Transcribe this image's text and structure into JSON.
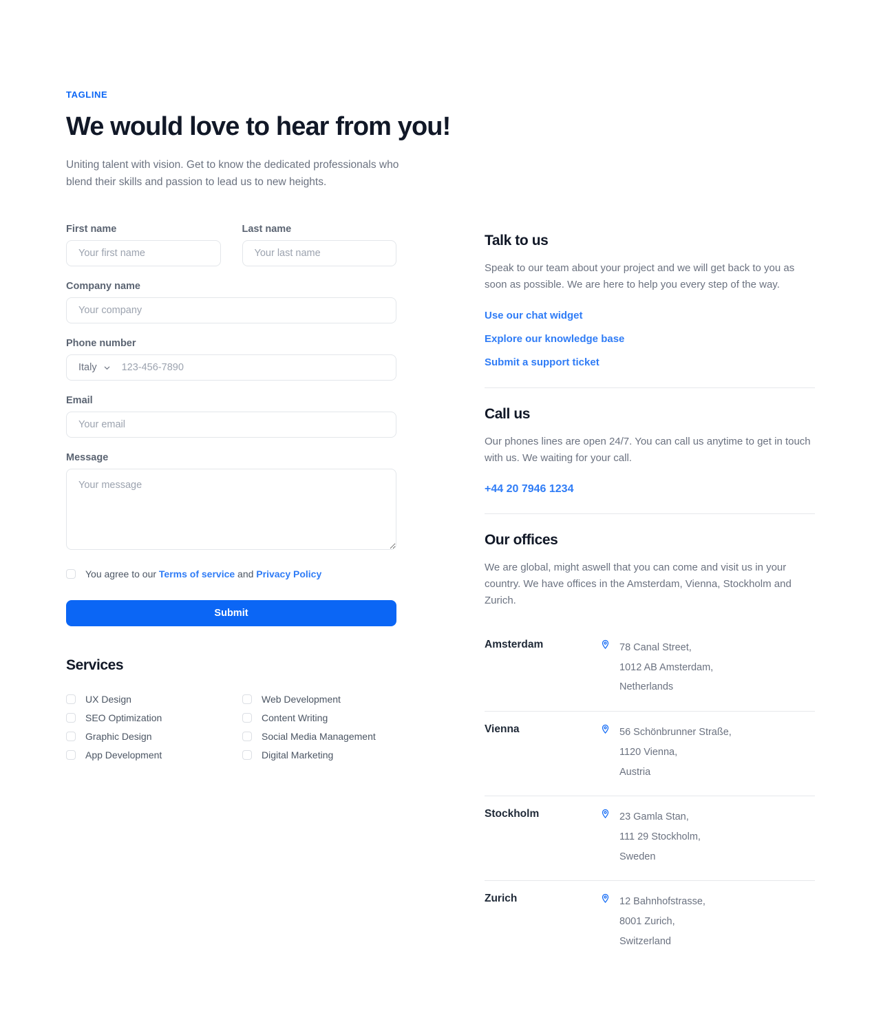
{
  "header": {
    "tagline": "TAGLINE",
    "title": "We would love to hear from you!",
    "subtitle": "Uniting talent with vision. Get to know the dedicated professionals who blend their skills and passion to lead us to new heights."
  },
  "colors": {
    "accent": "#0b66f5",
    "link": "#2f7cf6",
    "heading": "#111827",
    "body_text": "#6b7280",
    "border": "#e3e6ea",
    "divider": "#e6e8eb"
  },
  "form": {
    "first_name": {
      "label": "First name",
      "placeholder": "Your first name",
      "value": ""
    },
    "last_name": {
      "label": "Last name",
      "placeholder": "Your last name",
      "value": ""
    },
    "company_name": {
      "label": "Company name",
      "placeholder": "Your company",
      "value": ""
    },
    "phone": {
      "label": "Phone number",
      "country_selected": "Italy",
      "country_options": [
        "Italy"
      ],
      "placeholder": "123-456-7890",
      "value": ""
    },
    "email": {
      "label": "Email",
      "placeholder": "Your email",
      "value": ""
    },
    "message": {
      "label": "Message",
      "placeholder": "Your message",
      "value": ""
    },
    "agreement": {
      "checked": false,
      "text_before": "You agree to our ",
      "terms_link": "Terms of service",
      "text_between": " and ",
      "privacy_link": "Privacy Policy"
    },
    "submit_label": "Submit"
  },
  "services": {
    "title": "Services",
    "items": [
      {
        "label": "UX Design",
        "checked": false
      },
      {
        "label": "Web Development",
        "checked": false
      },
      {
        "label": "SEO Optimization",
        "checked": false
      },
      {
        "label": "Content Writing",
        "checked": false
      },
      {
        "label": "Graphic Design",
        "checked": false
      },
      {
        "label": "Social Media Management",
        "checked": false
      },
      {
        "label": "App Development",
        "checked": false
      },
      {
        "label": "Digital Marketing",
        "checked": false
      }
    ]
  },
  "talk_to_us": {
    "heading": "Talk to us",
    "body": "Speak to our team about your project and we will get back to you as soon as possible. We are here to help you every step of the way.",
    "links": [
      "Use our chat widget",
      "Explore our knowledge base",
      "Submit a support ticket"
    ]
  },
  "call_us": {
    "heading": "Call us",
    "body": "Our phones lines are open 24/7. You can call us anytime to get in touch with us. We waiting for your call.",
    "phone": "+44 20 7946 1234"
  },
  "our_offices": {
    "heading": "Our offices",
    "body": "We are global, might aswell that you can come and visit us in your country. We have offices in the Amsterdam, Vienna, Stockholm and Zurich.",
    "icon": "map-pin-icon",
    "offices": [
      {
        "city": "Amsterdam",
        "line1": "78 Canal Street,",
        "line2": "1012 AB Amsterdam,",
        "line3": "Netherlands"
      },
      {
        "city": "Vienna",
        "line1": "56 Schönbrunner Straße,",
        "line2": "1120 Vienna,",
        "line3": "Austria"
      },
      {
        "city": "Stockholm",
        "line1": "23 Gamla Stan,",
        "line2": "111 29 Stockholm,",
        "line3": "Sweden"
      },
      {
        "city": "Zurich",
        "line1": "12 Bahnhofstrasse,",
        "line2": "8001 Zurich,",
        "line3": "Switzerland"
      }
    ]
  }
}
